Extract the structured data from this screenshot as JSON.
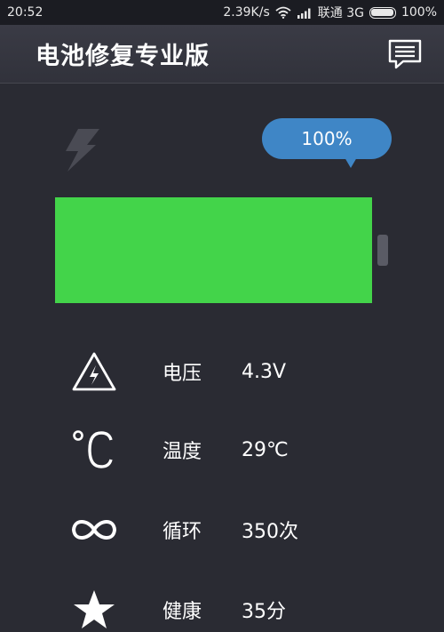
{
  "status_bar": {
    "time": "20:52",
    "speed": "2.39K/s",
    "carrier": "联通 3G",
    "battery": "100%",
    "icons": [
      "wifi-icon",
      "signal-icon",
      "battery-icon"
    ]
  },
  "app": {
    "title": "电池修复专业版",
    "menu_icon": "chat-bubble-icon"
  },
  "battery": {
    "percent_label": "100%",
    "level": 1.0,
    "fill_color": "#43d44a",
    "charging_icon": "lightning-icon"
  },
  "stats": [
    {
      "icon": "high-voltage-icon",
      "label": "电压",
      "value": "4.3V"
    },
    {
      "icon": "celsius-icon",
      "label": "温度",
      "value": "29℃"
    },
    {
      "icon": "infinity-icon",
      "label": "循环",
      "value": "350次"
    },
    {
      "icon": "star-icon",
      "label": "健康",
      "value": "35分"
    }
  ],
  "colors": {
    "background": "#2a2b33",
    "accent": "#3f86c6",
    "battery_green": "#43d44a"
  }
}
